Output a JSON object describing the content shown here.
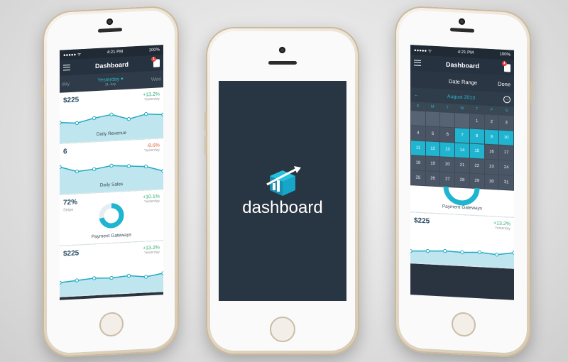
{
  "left": {
    "status": {
      "time": "4:21 PM",
      "battery": "100%"
    },
    "nav": {
      "title": "Dashboard",
      "badge": "1"
    },
    "days": {
      "prev": "day",
      "current": "Yesterday ▾",
      "current_sub": "11 July",
      "next": "Wee"
    },
    "cards": [
      {
        "value": "$225",
        "change": "+13.2%",
        "change_sub": "Yesterday",
        "label": "Daily Revenue",
        "trend": "pos",
        "points": [
          20,
          18,
          24,
          28,
          20,
          26,
          24
        ]
      },
      {
        "value": "6",
        "change": "-8.6%",
        "change_sub": "Yesterday",
        "label": "Daily Sales",
        "trend": "neg",
        "points": [
          30,
          22,
          24,
          28,
          26,
          24,
          16
        ]
      },
      {
        "value": "72%",
        "sub": "Stripe",
        "change": "+10.1%",
        "change_sub": "Yesterday",
        "label": "Payment Gateways",
        "trend": "pos",
        "donut": 72
      },
      {
        "value": "$225",
        "change": "+13.2%",
        "change_sub": "Yesterday",
        "label": "",
        "trend": "pos",
        "points": [
          10,
          12,
          14,
          13,
          15,
          12,
          16
        ]
      }
    ]
  },
  "center": {
    "splash_text": "dashboard"
  },
  "right": {
    "status": {
      "time": "4:21 PM",
      "battery": "100%"
    },
    "nav": {
      "title": "Dashboard",
      "badge": "1"
    },
    "date_range": {
      "title": "Date Range",
      "done": "Done"
    },
    "month": "August 2013",
    "weekdays": [
      "S",
      "M",
      "T",
      "W",
      "T",
      "F",
      "S"
    ],
    "calendar": [
      {
        "d": "",
        "s": "empty"
      },
      {
        "d": "",
        "s": "empty"
      },
      {
        "d": "",
        "s": "empty"
      },
      {
        "d": "",
        "s": "empty"
      },
      {
        "d": "1",
        "s": ""
      },
      {
        "d": "2",
        "s": ""
      },
      {
        "d": "3",
        "s": ""
      },
      {
        "d": "4",
        "s": ""
      },
      {
        "d": "5",
        "s": ""
      },
      {
        "d": "6",
        "s": ""
      },
      {
        "d": "7",
        "s": "sel"
      },
      {
        "d": "8",
        "s": "sel"
      },
      {
        "d": "9",
        "s": "sel"
      },
      {
        "d": "10",
        "s": "sel"
      },
      {
        "d": "11",
        "s": "sel"
      },
      {
        "d": "12",
        "s": "sel"
      },
      {
        "d": "13",
        "s": "sel"
      },
      {
        "d": "14",
        "s": "sel"
      },
      {
        "d": "15",
        "s": "sel"
      },
      {
        "d": "16",
        "s": ""
      },
      {
        "d": "17",
        "s": ""
      },
      {
        "d": "18",
        "s": ""
      },
      {
        "d": "19",
        "s": ""
      },
      {
        "d": "20",
        "s": ""
      },
      {
        "d": "21",
        "s": ""
      },
      {
        "d": "22",
        "s": ""
      },
      {
        "d": "23",
        "s": ""
      },
      {
        "d": "24",
        "s": ""
      },
      {
        "d": "25",
        "s": ""
      },
      {
        "d": "26",
        "s": ""
      },
      {
        "d": "27",
        "s": ""
      },
      {
        "d": "28",
        "s": ""
      },
      {
        "d": "29",
        "s": ""
      },
      {
        "d": "30",
        "s": ""
      },
      {
        "d": "31",
        "s": ""
      }
    ],
    "cards": [
      {
        "label": "Payment Gateways"
      },
      {
        "value": "$225",
        "change": "+13.2%",
        "change_sub": "Yesterday",
        "trend": "pos",
        "points": [
          10,
          12,
          14,
          13,
          15,
          12,
          18
        ]
      }
    ]
  },
  "colors": {
    "accent": "#1fb4d0",
    "dark": "#263240",
    "positive": "#2caa6e",
    "negative": "#e05a3a"
  }
}
